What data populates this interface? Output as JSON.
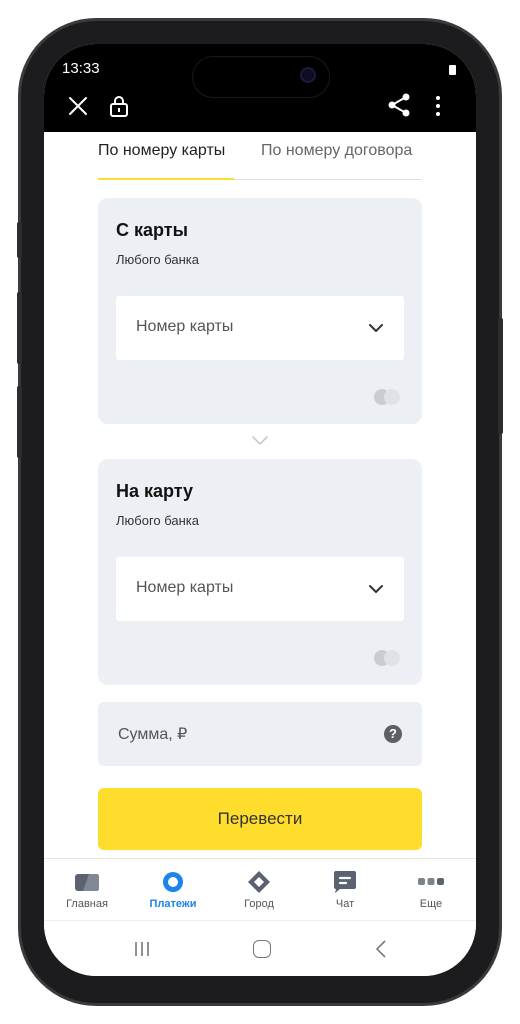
{
  "status_bar": {
    "time": "13:33"
  },
  "tabs": [
    {
      "label": "По номеру карты",
      "active": true
    },
    {
      "label": "По номеру договора",
      "active": false
    }
  ],
  "from_card": {
    "title": "С карты",
    "subtitle": "Любого банка",
    "placeholder": "Номер карты"
  },
  "to_card": {
    "title": "На карту",
    "subtitle": "Любого банка",
    "placeholder": "Номер карты"
  },
  "amount": {
    "placeholder": "Сумма, ₽",
    "help_glyph": "?"
  },
  "transfer_button": {
    "label": "Перевести"
  },
  "bottom_nav": [
    {
      "label": "Главная",
      "icon": "card-icon",
      "active": false
    },
    {
      "label": "Платежи",
      "icon": "payments-circle-icon",
      "active": true
    },
    {
      "label": "Город",
      "icon": "city-diamond-icon",
      "active": false
    },
    {
      "label": "Чат",
      "icon": "chat-icon",
      "active": false
    },
    {
      "label": "Еще",
      "icon": "more-dots-icon",
      "active": false
    }
  ],
  "colors": {
    "accent_yellow": "#ffdd2d",
    "active_blue": "#1c84ea",
    "card_bg": "#eceff4"
  }
}
